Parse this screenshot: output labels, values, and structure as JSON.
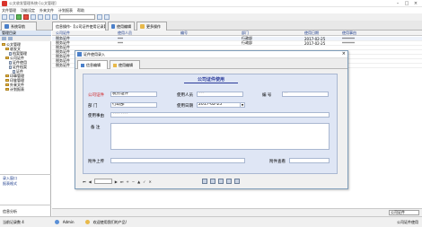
{
  "window": {
    "title": "公文收发管理系统-[公文管理]"
  },
  "menu": [
    "文件管理",
    "功能设定",
    "外来文件",
    "计划报表",
    "帮助"
  ],
  "tabs": [
    "系统导航",
    "信息操作-【公司证件使用记录】",
    "使用编辑",
    "更多操作"
  ],
  "left_pane": {
    "header": "管理目录",
    "tree": [
      "公文管理",
      "收发文",
      "档案管理",
      "公司证件",
      "证件使用",
      "证件档案",
      "证件",
      "印章管理",
      "印鉴管理",
      "外来文件",
      "计划报表"
    ],
    "links": [
      "录入窗口",
      "报表格式"
    ],
    "footer_link": "信息分析"
  },
  "grid": {
    "columns": [
      "公司证件",
      "使用人员",
      "编号",
      "部门",
      "使用日期",
      "使用事由"
    ],
    "rows": [
      [
        "税务证件",
        "***",
        "",
        "行政部",
        "2017-02-25",
        "*******"
      ],
      [
        "税务证件",
        "***",
        "",
        "行政部",
        "2017-02-25",
        "*******"
      ],
      [
        "税务证件",
        "",
        "",
        "",
        "",
        ""
      ],
      [
        "税务证件",
        "",
        "",
        "",
        "",
        ""
      ],
      [
        "税务证件",
        "",
        "",
        "",
        "",
        ""
      ],
      [
        "税务证件",
        "",
        "",
        "",
        "",
        ""
      ],
      [
        "税务证件",
        "",
        "",
        "",
        "",
        ""
      ]
    ],
    "footer_select": "公司证件"
  },
  "dialog": {
    "title": "证件使用录入",
    "tabs": [
      "信息编辑",
      "使用编辑"
    ],
    "form_title": "公司证件使用",
    "labels": {
      "cert": "公司证件",
      "user": "使用人员",
      "code": "编  号",
      "dept": "部  门",
      "date": "使用日期",
      "reason": "使用事由",
      "note": "备  注",
      "attach": "附件上传",
      "attach_view": "附件查看"
    },
    "values": {
      "cert": "税务证件",
      "user": "***",
      "code": "**",
      "dept": "行政部",
      "date": "2017-02-25",
      "reason": "********",
      "note": "",
      "attach": ""
    }
  },
  "status": {
    "left": "当前记录数 4",
    "user": "Admin",
    "message": "欢迎使用我们的产品!",
    "right": "公司证件使用"
  },
  "colors": {
    "label_red": "#d01818",
    "form_bg": "#dfe6f5",
    "title_blue": "#2a3a9a"
  }
}
